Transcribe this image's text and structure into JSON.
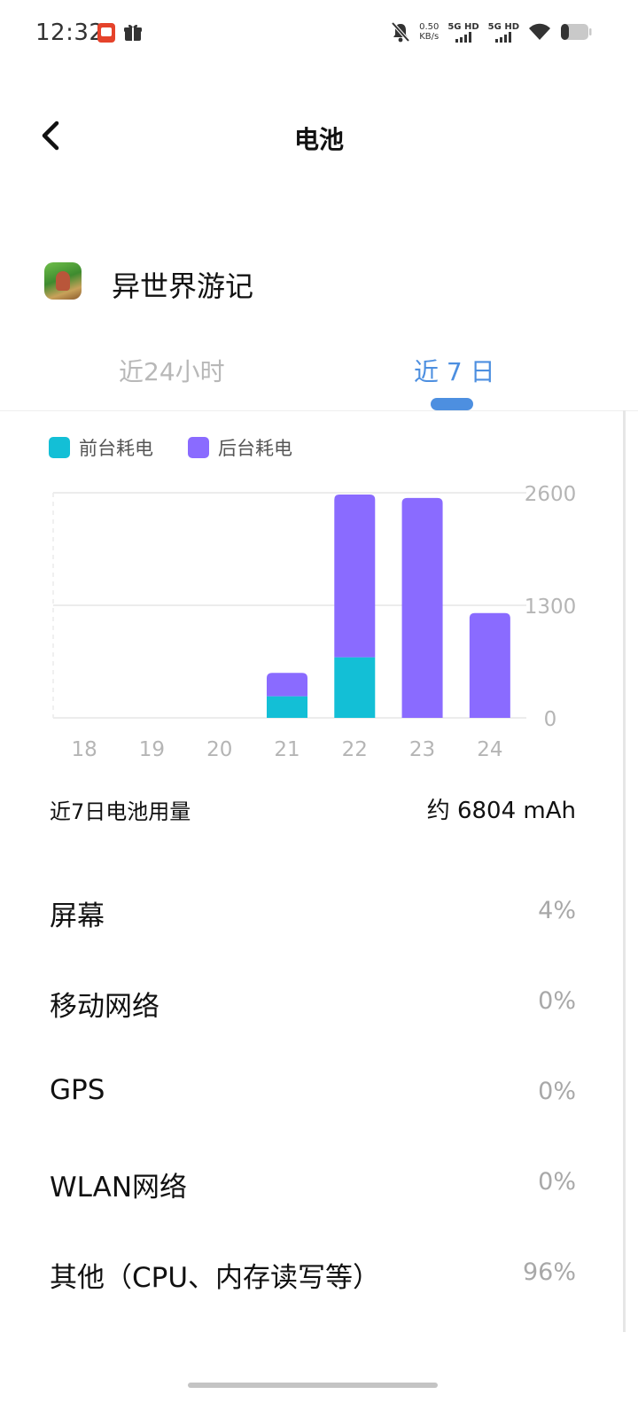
{
  "status_bar": {
    "time": "12:32",
    "speed_value": "0.50",
    "speed_unit": "KB/s",
    "sim1": "5G HD",
    "sim2": "5G HD"
  },
  "header": {
    "title": "电池"
  },
  "app": {
    "name": "异世界游记"
  },
  "tabs": [
    {
      "label": "近24小时",
      "selected": false
    },
    {
      "label": "近 7 日",
      "selected": true
    }
  ],
  "legend": [
    {
      "label": "前台耗电",
      "color": "#13bfd6"
    },
    {
      "label": "后台耗电",
      "color": "#8a6bff"
    }
  ],
  "chart_data": {
    "type": "bar",
    "stacked": true,
    "categories": [
      "18",
      "19",
      "20",
      "21",
      "22",
      "23",
      "24"
    ],
    "series": [
      {
        "name": "前台耗电",
        "color": "#13bfd6",
        "values": [
          0,
          0,
          0,
          250,
          700,
          0,
          0
        ]
      },
      {
        "name": "后台耗电",
        "color": "#8a6bff",
        "values": [
          0,
          0,
          0,
          270,
          1880,
          2540,
          1210
        ]
      }
    ],
    "y_ticks": [
      "0",
      "1300",
      "2600"
    ],
    "ylim": [
      0,
      2600
    ],
    "legend_position": "top-left",
    "grid": true
  },
  "summary": {
    "label": "近7日电池用量",
    "value": "约 6804 mAh"
  },
  "breakdown": [
    {
      "label": "屏幕",
      "value": "4%"
    },
    {
      "label": "移动网络",
      "value": "0%"
    },
    {
      "label": "GPS",
      "value": "0%"
    },
    {
      "label": "WLAN网络",
      "value": "0%"
    },
    {
      "label": "其他（CPU、内存读写等）",
      "value": "96%"
    }
  ]
}
